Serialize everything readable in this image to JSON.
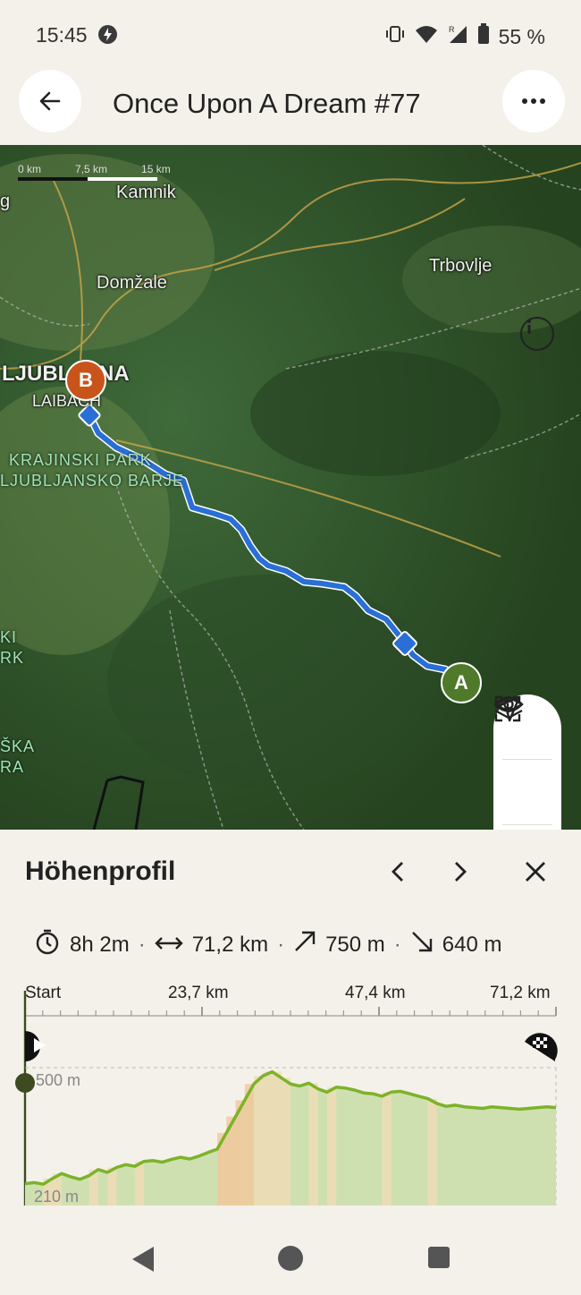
{
  "status": {
    "time": "15:45",
    "battery": "55 %"
  },
  "header": {
    "title": "Once Upon A Dream #77"
  },
  "map": {
    "scale_labels": [
      "0 km",
      "7,5 km",
      "15 km"
    ],
    "places": [
      "Kamnik",
      "Domžale",
      "Trbovlje",
      "LJUBLJANA",
      "LAIBACH"
    ],
    "park_lines": [
      "KRAJINSKI PARK",
      "LJUBLJANSKO BARJE"
    ],
    "edge_fragments": [
      "KI",
      "RK",
      "ŠKA",
      "RA",
      "g"
    ],
    "marker_start": "A",
    "marker_end": "B",
    "controls": [
      "eye-icon",
      "crosshair-plus-icon",
      "layers-icon",
      "navigate-icon"
    ]
  },
  "profile": {
    "title": "Höhenprofil",
    "duration": "8h 2m",
    "distance": "71,2 km",
    "ascent": "750 m",
    "descent": "640 m",
    "km_labels": [
      "Start",
      "23,7 km",
      "47,4 km",
      "71,2 km"
    ],
    "y_top": "500 m",
    "y_bottom": "210 m",
    "elevation_m": [
      215,
      218,
      214,
      228,
      240,
      232,
      226,
      235,
      250,
      243,
      255,
      262,
      258,
      270,
      272,
      268,
      275,
      280,
      276,
      283,
      292,
      300,
      340,
      380,
      420,
      460,
      480,
      490,
      475,
      460,
      455,
      462,
      448,
      440,
      452,
      450,
      445,
      438,
      436,
      430,
      440,
      442,
      436,
      430,
      424,
      412,
      405,
      408,
      404,
      402,
      400,
      404,
      402,
      400,
      398,
      400,
      402,
      404,
      402
    ]
  }
}
